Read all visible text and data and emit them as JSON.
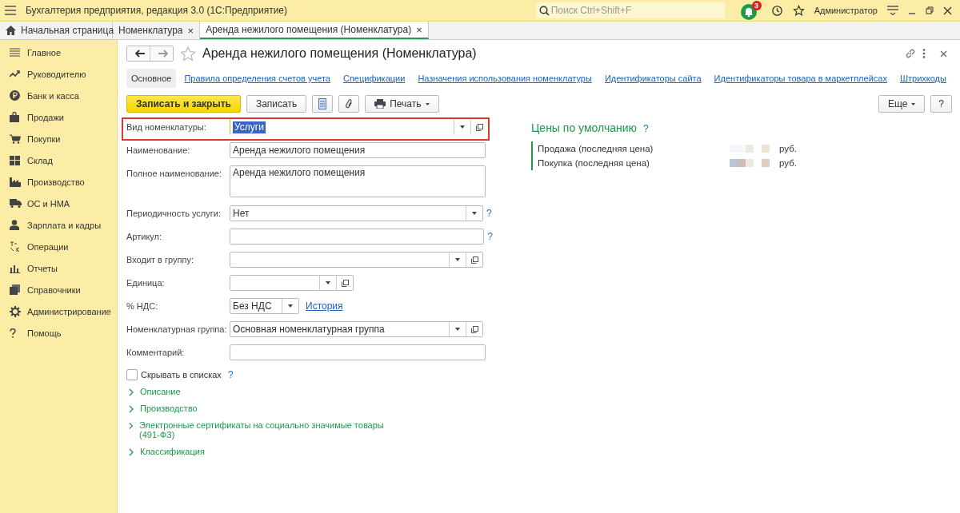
{
  "titlebar": {
    "title": "Бухгалтерия предприятия, редакция 3.0  (1С:Предприятие)",
    "search_placeholder": "Поиск Ctrl+Shift+F",
    "notifications": "3",
    "user": "Администратор"
  },
  "tabs": [
    {
      "label": "Начальная страница",
      "selected": false,
      "closable": false
    },
    {
      "label": "Номенклатура",
      "selected": false,
      "closable": true
    },
    {
      "label": "Аренда нежилого помещения (Номенклатура)",
      "selected": true,
      "closable": true
    }
  ],
  "tab_close": "×",
  "sidebar": {
    "items": [
      {
        "label": "Главное"
      },
      {
        "label": "Руководителю"
      },
      {
        "label": "Банк и касса"
      },
      {
        "label": "Продажи"
      },
      {
        "label": "Покупки"
      },
      {
        "label": "Склад"
      },
      {
        "label": "Производство"
      },
      {
        "label": "ОС и НМА"
      },
      {
        "label": "Зарплата и кадры"
      },
      {
        "label": "Операции"
      },
      {
        "label": "Отчеты"
      },
      {
        "label": "Справочники"
      },
      {
        "label": "Администрирование"
      },
      {
        "label": "Помощь"
      }
    ]
  },
  "form": {
    "title": "Аренда нежилого помещения (Номенклатура)",
    "sections": [
      {
        "label": "Основное",
        "selected": true
      },
      {
        "label": "Правила определения счетов учета",
        "selected": false
      },
      {
        "label": "Спецификации",
        "selected": false
      },
      {
        "label": "Назначения использования номенклатуры",
        "selected": false
      },
      {
        "label": "Идентификаторы сайта",
        "selected": false
      },
      {
        "label": "Идентификаторы товара в маркетплейсах",
        "selected": false
      },
      {
        "label": "Штрихкоды",
        "selected": false
      }
    ],
    "toolbar": {
      "primary": "Записать и закрыть",
      "save": "Записать",
      "print": "Печать",
      "more": "Еще",
      "help": "?"
    },
    "fields": [
      {
        "label": "Вид номенклатуры:",
        "kind": "combo",
        "value": "Услуги",
        "open_button": true,
        "highlighted": true,
        "help": false
      },
      {
        "label": "Наименование:",
        "kind": "text",
        "value": "Аренда нежилого помещения",
        "open_button": false,
        "highlighted": false,
        "help": false
      },
      {
        "label": "Полное наименование:",
        "kind": "textarea",
        "value": "Аренда нежилого помещения",
        "open_button": false,
        "highlighted": false,
        "help": false
      },
      {
        "label": "Периодичность услуги:",
        "kind": "combo",
        "value": "Нет",
        "open_button": false,
        "highlighted": false,
        "help": true
      },
      {
        "label": "Артикул:",
        "kind": "text",
        "open_button": false,
        "highlighted": false,
        "help": true
      },
      {
        "label": "Входит в группу:",
        "kind": "combo",
        "open_button": true,
        "highlighted": false,
        "help": false
      },
      {
        "label": "Единица:",
        "kind": "combo",
        "open_button": true,
        "highlighted": false,
        "help": false
      },
      {
        "label": "% НДС:",
        "kind": "combo",
        "value": "Без НДС",
        "open_button": false,
        "highlighted": false,
        "help": false,
        "link": "История"
      },
      {
        "label": "Номенклатурная группа:",
        "kind": "combo",
        "value": "Основная номенклатурная группа",
        "open_button": true,
        "highlighted": false,
        "help": false
      },
      {
        "label": "Комментарий:",
        "kind": "text",
        "open_button": false,
        "highlighted": false,
        "help": false
      }
    ],
    "help_mark": "?",
    "checkbox": {
      "label": "Скрывать в списках",
      "checked": false
    },
    "groups": [
      {
        "label": "Описание",
        "expanded": false
      },
      {
        "label": "Производство",
        "expanded": false
      },
      {
        "label": "Электронные сертификаты на социально значимые товары (491-ФЗ)",
        "expanded": false
      },
      {
        "label": "Классификация",
        "expanded": false
      }
    ],
    "prices": {
      "title": "Цены по умолчанию",
      "rows": [
        {
          "label": "Продажа (последняя цена)",
          "currency": "руб."
        },
        {
          "label": "Покупка (последняя цена)",
          "currency": "руб."
        }
      ]
    }
  }
}
